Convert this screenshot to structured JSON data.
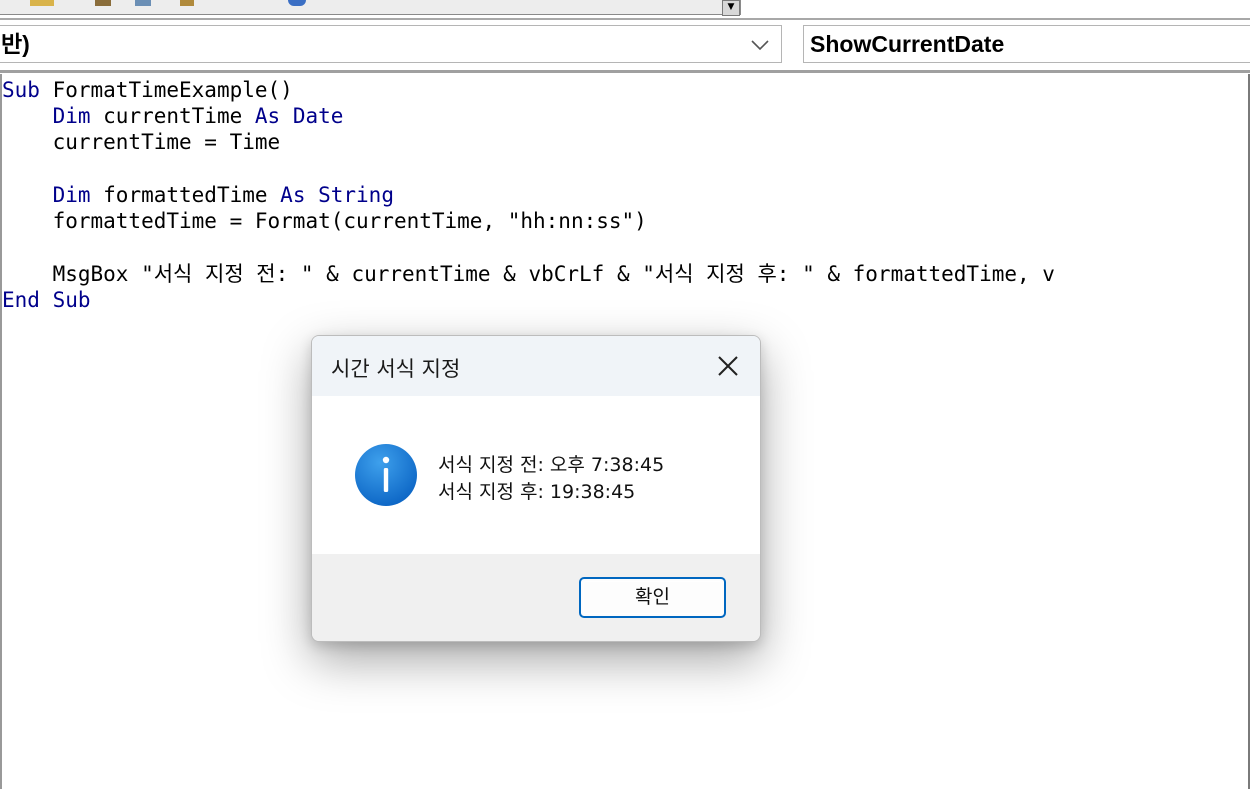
{
  "combos": {
    "object_value": "반)",
    "procedure_value": "ShowCurrentDate"
  },
  "code": {
    "lines": [
      {
        "indent": "",
        "parts": [
          {
            "t": "Sub",
            "kw": true
          },
          {
            "t": " FormatTimeExample()",
            "kw": false
          }
        ]
      },
      {
        "indent": "    ",
        "parts": [
          {
            "t": "Dim",
            "kw": true
          },
          {
            "t": " currentTime ",
            "kw": false
          },
          {
            "t": "As Date",
            "kw": true
          }
        ]
      },
      {
        "indent": "    ",
        "parts": [
          {
            "t": "currentTime = Time",
            "kw": false
          }
        ]
      },
      {
        "indent": "",
        "parts": []
      },
      {
        "indent": "    ",
        "parts": [
          {
            "t": "Dim",
            "kw": true
          },
          {
            "t": " formattedTime ",
            "kw": false
          },
          {
            "t": "As String",
            "kw": true
          }
        ]
      },
      {
        "indent": "    ",
        "parts": [
          {
            "t": "formattedTime = Format(currentTime, \"hh:nn:ss\")",
            "kw": false
          }
        ]
      },
      {
        "indent": "",
        "parts": []
      },
      {
        "indent": "    ",
        "parts": [
          {
            "t": "MsgBox \"서식 지정 전: \" & currentTime & vbCrLf & \"서식 지정 후: \" & formattedTime, v",
            "kw": false
          }
        ]
      },
      {
        "indent": "",
        "parts": [
          {
            "t": "End Sub",
            "kw": true
          }
        ]
      }
    ]
  },
  "dialog": {
    "title": "시간 서식 지정",
    "message_line1": "서식 지정 전: 오후 7:38:45",
    "message_line2": "서식 지정 후: 19:38:45",
    "ok_label": "확인",
    "icon": "info-icon",
    "close_icon": "close-icon"
  },
  "colors": {
    "keyword": "#00008b",
    "info_icon": "#1a7fd4",
    "button_border": "#0067c0"
  }
}
